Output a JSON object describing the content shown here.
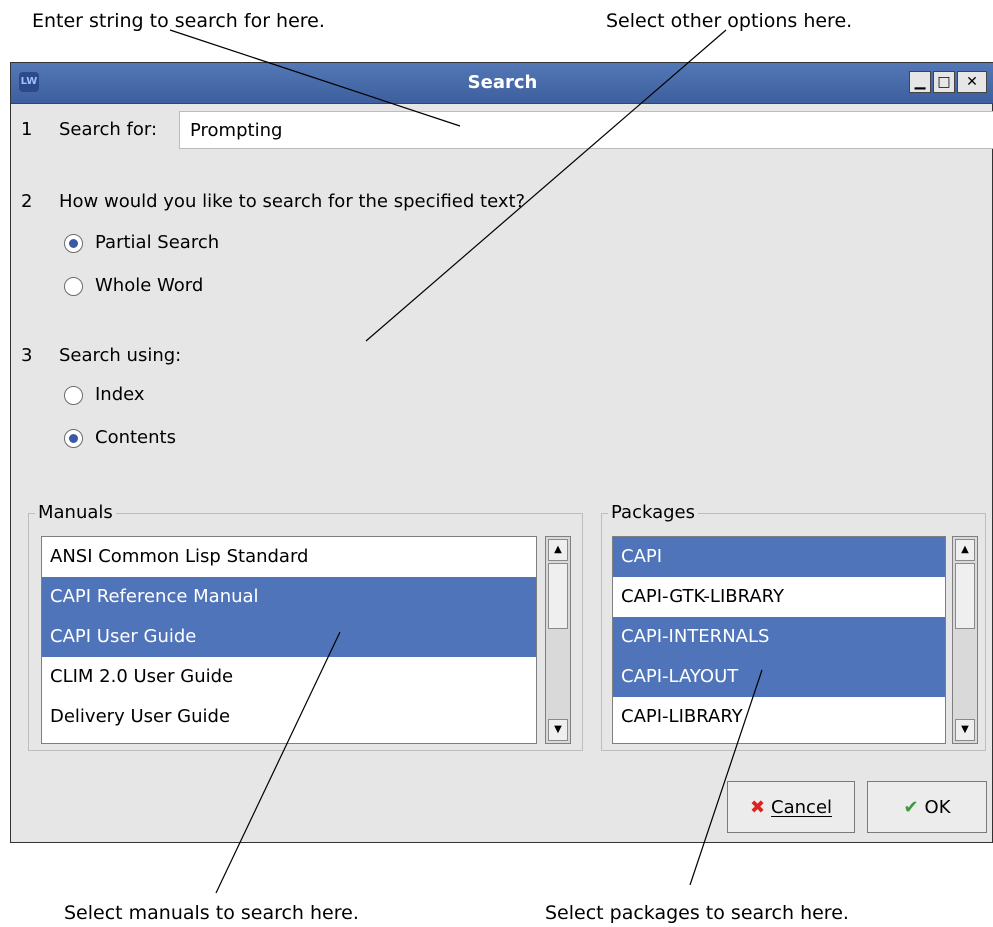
{
  "callouts": {
    "search_string": "Enter string to search for here.",
    "other_options": "Select other options here.",
    "manuals": "Select manuals to search here.",
    "packages": "Select packages to search here."
  },
  "window": {
    "title": "Search",
    "app_icon": "lispworks-icon"
  },
  "section1": {
    "num": "1",
    "label": "Search for:",
    "input_value": "Prompting"
  },
  "section2": {
    "num": "2",
    "question": "How would you like to search for the specified text?",
    "options": [
      {
        "label": "Partial Search",
        "selected": true
      },
      {
        "label": "Whole Word",
        "selected": false
      }
    ]
  },
  "section3": {
    "num": "3",
    "label": "Search using:",
    "options": [
      {
        "label": "Index",
        "selected": false
      },
      {
        "label": "Contents",
        "selected": true
      }
    ]
  },
  "manuals": {
    "legend": "Manuals",
    "items": [
      {
        "label": "ANSI Common Lisp Standard",
        "selected": false
      },
      {
        "label": "CAPI Reference Manual",
        "selected": true
      },
      {
        "label": "CAPI User Guide",
        "selected": true
      },
      {
        "label": "CLIM 2.0 User Guide",
        "selected": false
      },
      {
        "label": "Delivery User Guide",
        "selected": false
      }
    ]
  },
  "packages": {
    "legend": "Packages",
    "items": [
      {
        "label": "CAPI",
        "selected": true
      },
      {
        "label": "CAPI-GTK-LIBRARY",
        "selected": false
      },
      {
        "label": "CAPI-INTERNALS",
        "selected": true
      },
      {
        "label": "CAPI-LAYOUT",
        "selected": true
      },
      {
        "label": "CAPI-LIBRARY",
        "selected": false
      }
    ]
  },
  "buttons": {
    "cancel": "Cancel",
    "ok": "OK"
  },
  "colors": {
    "titlebar": "#4a6aaa",
    "selection": "#5074b9",
    "dialog_bg": "#e6e6e6"
  }
}
